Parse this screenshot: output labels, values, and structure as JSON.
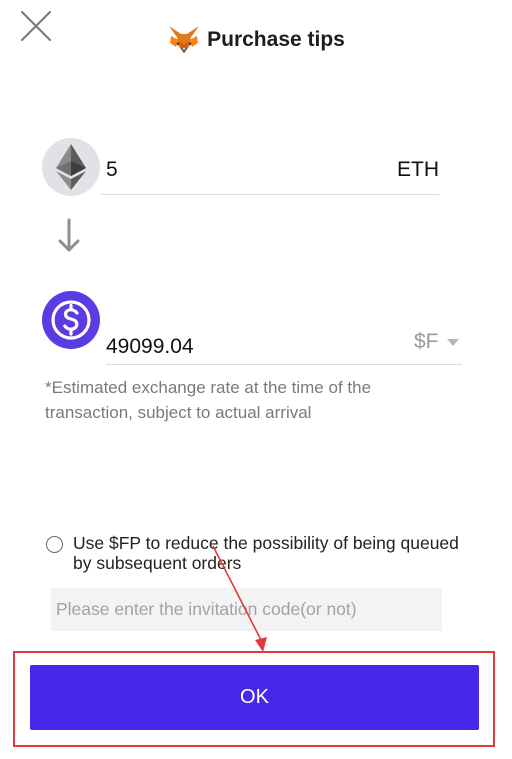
{
  "header": {
    "title": "Purchase tips",
    "close_icon": "close-icon",
    "logo_icon": "fox-logo-icon"
  },
  "pay": {
    "value": "5",
    "unit": "ETH",
    "icon": "ethereum-icon"
  },
  "convert_icon": "arrow-down-icon",
  "receive": {
    "value": "49099.04",
    "unit": "$F",
    "icon": "dollar-coin-icon"
  },
  "note": "*Estimated exchange rate at the time of the transaction, subject to actual arrival",
  "option": {
    "label": "Use $FP to reduce the possibility of being queued by subsequent orders",
    "checked": false
  },
  "invitation": {
    "placeholder": "Please enter the invitation code(or not)",
    "value": ""
  },
  "ok_button": {
    "label": "OK"
  },
  "colors": {
    "accent": "#4628e8",
    "coin_purple": "#5b3be3",
    "annotation_red": "#e13a3a"
  }
}
